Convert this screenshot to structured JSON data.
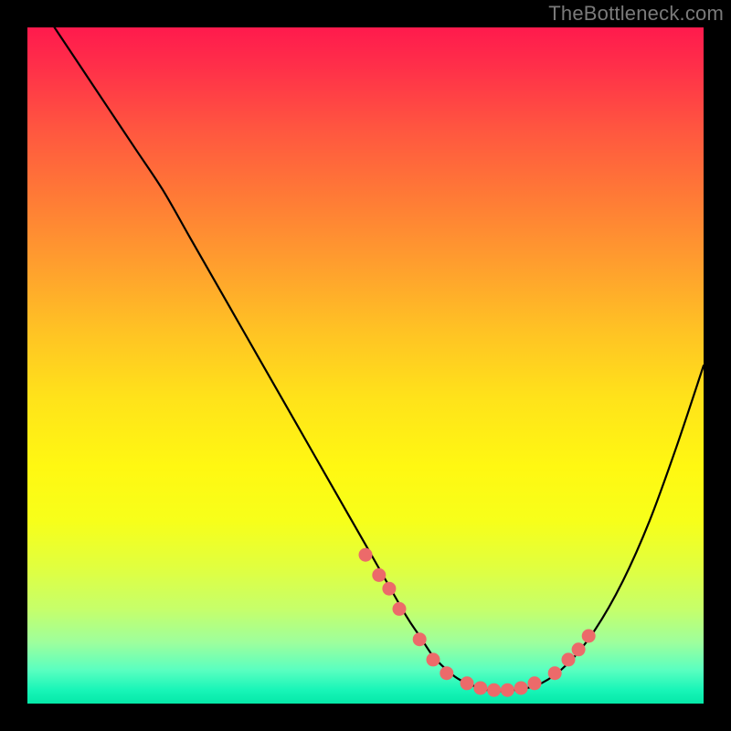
{
  "watermark": "TheBottleneck.com",
  "chart_data": {
    "type": "line",
    "title": "",
    "xlabel": "",
    "ylabel": "",
    "xlim": [
      0,
      100
    ],
    "ylim": [
      0,
      100
    ],
    "series": [
      {
        "name": "bottleneck-curve",
        "x": [
          4,
          8,
          12,
          16,
          20,
          24,
          28,
          32,
          36,
          40,
          44,
          48,
          52,
          56,
          58,
          60,
          62,
          64,
          68,
          72,
          76,
          80,
          84,
          88,
          92,
          96,
          100
        ],
        "values": [
          100,
          94,
          88,
          82,
          76,
          69,
          62,
          55,
          48,
          41,
          34,
          27,
          20,
          13,
          10,
          7,
          5,
          3.5,
          2,
          2,
          3,
          6,
          11,
          18,
          27,
          38,
          50
        ]
      }
    ],
    "markers": {
      "name": "highlight-points",
      "color": "#ec6a6a",
      "x": [
        50,
        52,
        53.5,
        55,
        58,
        60,
        62,
        65,
        67,
        69,
        71,
        73,
        75,
        78,
        80,
        81.5,
        83
      ],
      "values": [
        22,
        19,
        17,
        14,
        9.5,
        6.5,
        4.5,
        3,
        2.3,
        2,
        2,
        2.3,
        3,
        4.5,
        6.5,
        8,
        10
      ]
    }
  },
  "colors": {
    "curve": "#000000",
    "marker": "#ec6a6a",
    "background_top": "#ff1a4d",
    "background_bottom": "#05e8a8",
    "frame": "#000000"
  }
}
